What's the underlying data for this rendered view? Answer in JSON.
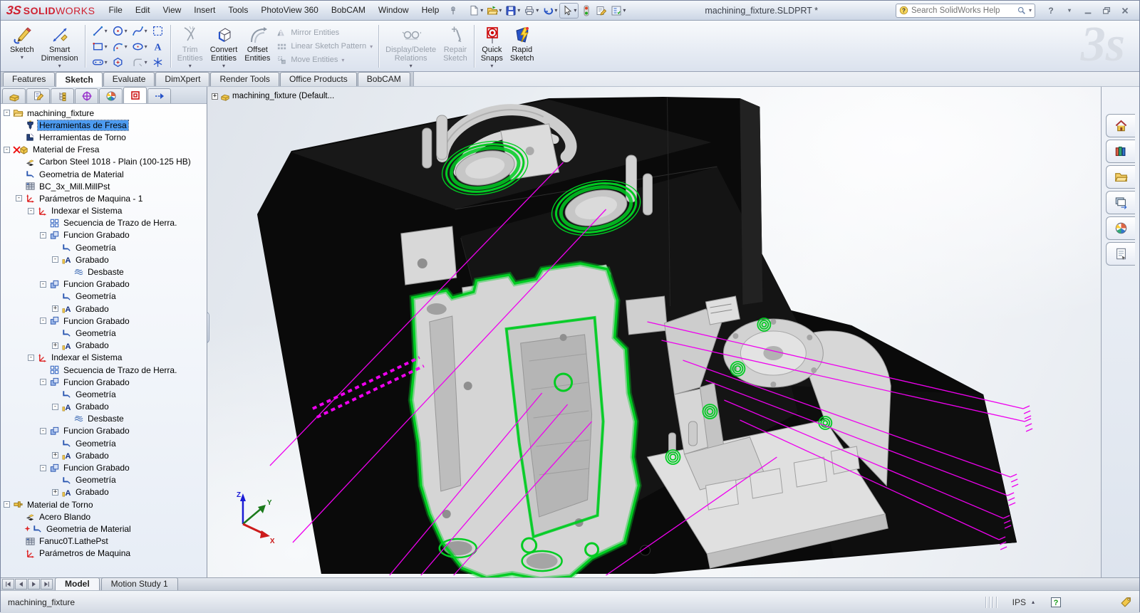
{
  "window": {
    "title": "machining_fixture.SLDPRT *",
    "brand": {
      "logo": "3S",
      "name_bold": "SOLID",
      "name_light": "WORKS"
    }
  },
  "menu": {
    "items": [
      "File",
      "Edit",
      "View",
      "Insert",
      "Tools",
      "PhotoView 360",
      "BobCAM",
      "Window",
      "Help"
    ]
  },
  "quick_access": {
    "items": [
      {
        "icon": "new-document",
        "caret": true
      },
      {
        "icon": "open-folder",
        "caret": true
      },
      {
        "icon": "save",
        "caret": true
      },
      {
        "icon": "print",
        "caret": true
      },
      {
        "icon": "undo",
        "caret": true
      },
      {
        "icon": "select-cursor",
        "caret": true,
        "boxed": true
      },
      {
        "icon": "rebuild-light",
        "caret": false
      },
      {
        "icon": "file-properties",
        "caret": false
      },
      {
        "icon": "options-list",
        "caret": true
      }
    ]
  },
  "search": {
    "placeholder": "Search SolidWorks Help"
  },
  "ribbon": {
    "sketch": {
      "label": "Sketch"
    },
    "smart_dimension": {
      "label": "Smart\nDimension"
    },
    "trim": {
      "label": "Trim\nEntities"
    },
    "convert": {
      "label": "Convert\nEntities"
    },
    "offset": {
      "label": "Offset\nEntities"
    },
    "mirror": {
      "label": "Mirror Entities"
    },
    "linear": {
      "label": "Linear Sketch Pattern"
    },
    "move": {
      "label": "Move Entities"
    },
    "ddr": {
      "label": "Display/Delete\nRelations"
    },
    "repair": {
      "label": "Repair\nSketch"
    },
    "quick_snaps": {
      "label": "Quick\nSnaps"
    },
    "rapid": {
      "label": "Rapid\nSketch"
    },
    "entity_grid": [
      [
        {
          "icon": "line",
          "caret": true
        },
        {
          "icon": "circle",
          "caret": true
        },
        {
          "icon": "spline",
          "caret": true
        },
        {
          "icon": "select-box",
          "caret": false
        }
      ],
      [
        {
          "icon": "rectangle",
          "caret": true
        },
        {
          "icon": "arc",
          "caret": true
        },
        {
          "icon": "ellipse",
          "caret": true
        },
        {
          "icon": "text",
          "caret": false
        }
      ],
      [
        {
          "icon": "slot",
          "caret": true
        },
        {
          "icon": "polygon",
          "caret": false
        },
        {
          "icon": "fillet",
          "caret": true,
          "dis": true
        },
        {
          "icon": "point",
          "caret": false
        }
      ]
    ]
  },
  "tabs": {
    "items": [
      "Features",
      "Sketch",
      "Evaluate",
      "DimXpert",
      "Render Tools",
      "Office Products",
      "BobCAM"
    ],
    "active": "Sketch"
  },
  "panel_tabs": {
    "items": [
      "part-tree",
      "property-mgr",
      "config-mgr",
      "dimxpert-mgr",
      "display-mgr",
      "bobcam-mgr",
      "pin-arrow"
    ],
    "active": "bobcam-mgr"
  },
  "tree": {
    "items": [
      {
        "label": "machining_fixture",
        "depth": 0,
        "icon": "folder",
        "exp": "minus"
      },
      {
        "label": "Herramientas de Fresa",
        "depth": 1,
        "icon": "mill-tool",
        "exp": "none",
        "selected": true
      },
      {
        "label": "Herramientas de Torno",
        "depth": 1,
        "icon": "lathe-tool",
        "exp": "none"
      },
      {
        "label": "Material de Fresa",
        "depth": 0,
        "icon": "stock-box",
        "exp": "minus",
        "mark": "x"
      },
      {
        "label": "Carbon Steel 1018 - Plain (100-125 HB)",
        "depth": 1,
        "icon": "material-chips",
        "exp": "none"
      },
      {
        "label": "Geometria de Material",
        "depth": 1,
        "icon": "geometry-corner",
        "exp": "none"
      },
      {
        "label": "BC_3x_Mill.MillPst",
        "depth": 1,
        "icon": "post-grid",
        "exp": "none"
      },
      {
        "label": "Parámetros de Maquina - 1",
        "depth": 1,
        "icon": "machine-axes",
        "exp": "minus"
      },
      {
        "label": "Indexar el Sistema",
        "depth": 2,
        "icon": "machine-axes",
        "exp": "minus"
      },
      {
        "label": "Secuencia de Trazo de Herra.",
        "depth": 3,
        "icon": "sequence-grid",
        "exp": "none"
      },
      {
        "label": "Funcion Grabado",
        "depth": 3,
        "icon": "function-squares",
        "exp": "minus"
      },
      {
        "label": "Geometría",
        "depth": 4,
        "icon": "geometry-corner",
        "exp": "none"
      },
      {
        "label": "Grabado",
        "depth": 4,
        "icon": "engrave-a",
        "exp": "minus"
      },
      {
        "label": "Desbaste",
        "depth": 5,
        "icon": "hatch",
        "exp": "none"
      },
      {
        "label": "Funcion Grabado",
        "depth": 3,
        "icon": "function-squares",
        "exp": "minus"
      },
      {
        "label": "Geometría",
        "depth": 4,
        "icon": "geometry-corner",
        "exp": "none"
      },
      {
        "label": "Grabado",
        "depth": 4,
        "icon": "engrave-a",
        "exp": "plus"
      },
      {
        "label": "Funcion Grabado",
        "depth": 3,
        "icon": "function-squares",
        "exp": "minus"
      },
      {
        "label": "Geometría",
        "depth": 4,
        "icon": "geometry-corner",
        "exp": "none"
      },
      {
        "label": "Grabado",
        "depth": 4,
        "icon": "engrave-a",
        "exp": "plus"
      },
      {
        "label": "Indexar el Sistema",
        "depth": 2,
        "icon": "machine-axes",
        "exp": "minus"
      },
      {
        "label": "Secuencia de Trazo de Herra.",
        "depth": 3,
        "icon": "sequence-grid",
        "exp": "none"
      },
      {
        "label": "Funcion Grabado",
        "depth": 3,
        "icon": "function-squares",
        "exp": "minus"
      },
      {
        "label": "Geometría",
        "depth": 4,
        "icon": "geometry-corner",
        "exp": "none"
      },
      {
        "label": "Grabado",
        "depth": 4,
        "icon": "engrave-a",
        "exp": "minus"
      },
      {
        "label": "Desbaste",
        "depth": 5,
        "icon": "hatch",
        "exp": "none"
      },
      {
        "label": "Funcion Grabado",
        "depth": 3,
        "icon": "function-squares",
        "exp": "minus"
      },
      {
        "label": "Geometría",
        "depth": 4,
        "icon": "geometry-corner",
        "exp": "none"
      },
      {
        "label": "Grabado",
        "depth": 4,
        "icon": "engrave-a",
        "exp": "plus"
      },
      {
        "label": "Funcion Grabado",
        "depth": 3,
        "icon": "function-squares",
        "exp": "minus"
      },
      {
        "label": "Geometría",
        "depth": 4,
        "icon": "geometry-corner",
        "exp": "none"
      },
      {
        "label": "Grabado",
        "depth": 4,
        "icon": "engrave-a",
        "exp": "plus"
      },
      {
        "label": "Material de Torno",
        "depth": 0,
        "icon": "lathe-stock",
        "exp": "minus"
      },
      {
        "label": "Acero Blando",
        "depth": 1,
        "icon": "material-chips",
        "exp": "none"
      },
      {
        "label": "Geometria de Material",
        "depth": 1,
        "icon": "geometry-corner",
        "exp": "none",
        "mark": "star"
      },
      {
        "label": "Fanuc0T.LathePst",
        "depth": 1,
        "icon": "post-grid",
        "exp": "none"
      },
      {
        "label": "Parámetros de Maquina",
        "depth": 1,
        "icon": "machine-axes",
        "exp": "none"
      }
    ]
  },
  "viewport": {
    "label": "machining_fixture  (Default...",
    "triad": {
      "x": "X",
      "y": "Y",
      "z": "Z"
    }
  },
  "headsup": {
    "items": [
      {
        "icon": "zoom-fit",
        "caret": false
      },
      {
        "icon": "zoom-area",
        "caret": false
      },
      {
        "icon": "prev-view",
        "caret": false
      },
      {
        "icon": "section-view",
        "caret": false
      },
      {
        "icon": "view-orient",
        "caret": true
      },
      {
        "icon": "display-style",
        "caret": true
      },
      {
        "icon": "hide-show",
        "caret": true
      },
      {
        "icon": "appearance",
        "caret": false
      },
      {
        "icon": "scene",
        "caret": true
      },
      {
        "icon": "view-settings",
        "caret": true
      }
    ]
  },
  "doc_controls": {
    "items": [
      "pane-left",
      "pane-right",
      "win-min",
      "win-restore",
      "win-close"
    ]
  },
  "task_pane": {
    "items": [
      "home",
      "design-library",
      "file-explorer",
      "view-palette",
      "appearance",
      "custom-props"
    ]
  },
  "model_tabs": {
    "nav": [
      "nav-first",
      "nav-prev",
      "nav-next",
      "nav-last"
    ],
    "items": [
      "Model",
      "Motion Study 1"
    ],
    "active": "Model"
  },
  "status": {
    "left": "machining_fixture",
    "units": "IPS"
  },
  "colors": {
    "toolpath_green": "#00cc22",
    "rapid_magenta": "#ee00ee",
    "selection_blue": "#4d9bf0",
    "brand_red": "#cf2030"
  }
}
